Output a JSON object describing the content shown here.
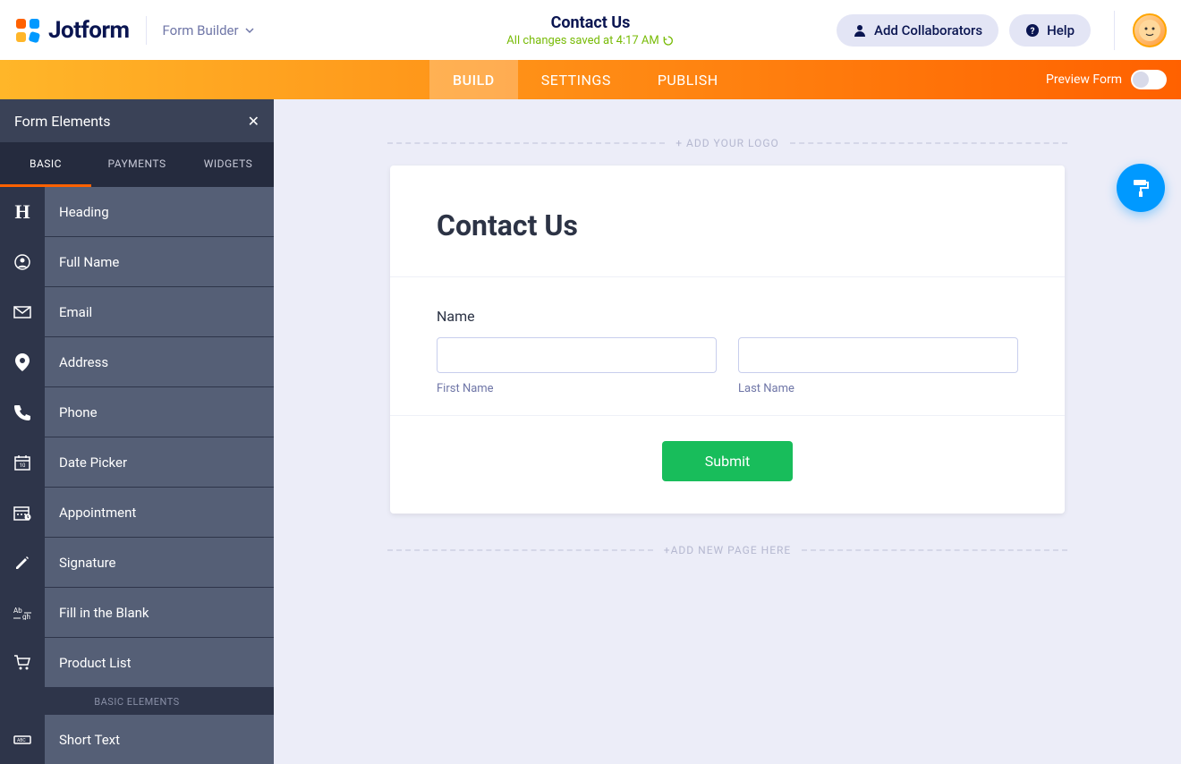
{
  "header": {
    "brand": "Jotform",
    "mode": "Form Builder",
    "title": "Contact Us",
    "saved": "All changes saved at 4:17 AM",
    "collab": "Add Collaborators",
    "help": "Help"
  },
  "nav": {
    "tabs": [
      "BUILD",
      "SETTINGS",
      "PUBLISH"
    ],
    "preview": "Preview Form"
  },
  "sidebar": {
    "title": "Form Elements",
    "tabs": [
      "BASIC",
      "PAYMENTS",
      "WIDGETS"
    ],
    "items": [
      {
        "label": "Heading"
      },
      {
        "label": "Full Name"
      },
      {
        "label": "Email"
      },
      {
        "label": "Address"
      },
      {
        "label": "Phone"
      },
      {
        "label": "Date Picker"
      },
      {
        "label": "Appointment"
      },
      {
        "label": "Signature"
      },
      {
        "label": "Fill in the Blank"
      },
      {
        "label": "Product List"
      }
    ],
    "section": "BASIC ELEMENTS",
    "items2": [
      {
        "label": "Short Text"
      }
    ]
  },
  "canvas": {
    "addLogo": "+ ADD YOUR LOGO",
    "addPage": "+ADD NEW PAGE HERE",
    "formTitle": "Contact Us",
    "nameLabel": "Name",
    "firstName": "First Name",
    "lastName": "Last Name",
    "submit": "Submit"
  }
}
